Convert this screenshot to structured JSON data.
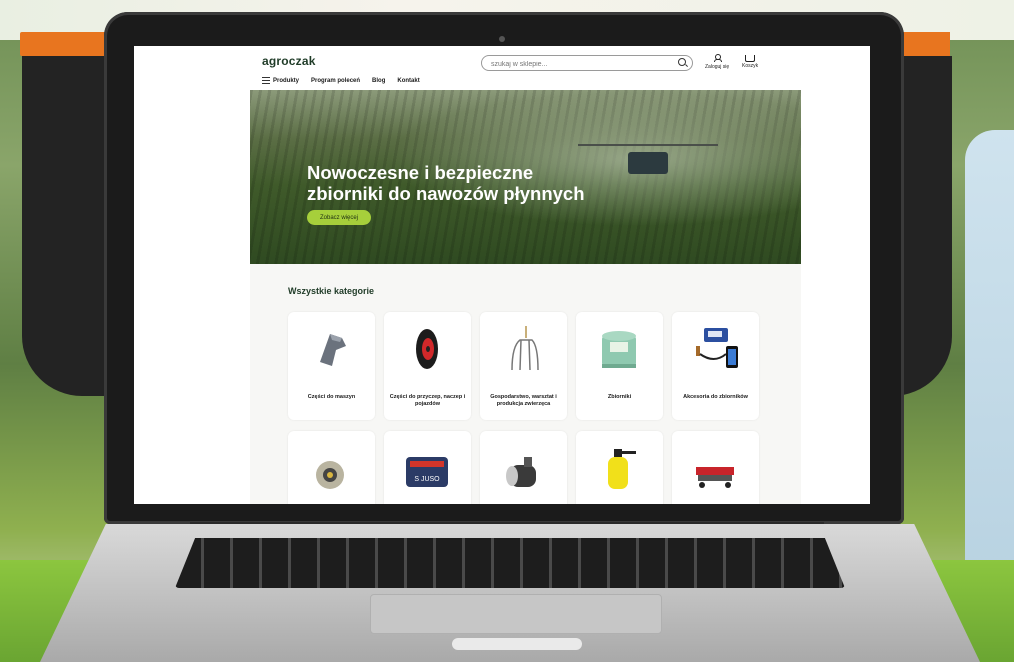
{
  "site": {
    "logo": "agroczak",
    "search_placeholder": "szukaj w sklepie...",
    "header_links": {
      "login": "Zaloguj się",
      "cart": "Koszyk"
    },
    "nav": [
      "Produkty",
      "Program poleceń",
      "Blog",
      "Kontakt"
    ],
    "hero": {
      "title_line1": "Nowoczesne i bezpieczne",
      "title_line2": "zbiorniki do nawozów płynnych",
      "button": "Zobacz więcej"
    },
    "categories_title": "Wszystkie kategorie",
    "categories": [
      {
        "label": "Części do maszyn",
        "icon": "machine-part-icon"
      },
      {
        "label": "Części do przyczep, naczep i pojazdów",
        "icon": "wheel-icon"
      },
      {
        "label": "Gospodarstwo, warsztat i produkcja zwierzęca",
        "icon": "pitchfork-icon"
      },
      {
        "label": "Zbiorniki",
        "icon": "tank-icon"
      },
      {
        "label": "Akcesoria do zbiorników",
        "icon": "tank-sensor-icon"
      },
      {
        "label": "",
        "icon": "alternator-icon"
      },
      {
        "label": "",
        "icon": "fuel-tank-icon",
        "badge": "S JUSO"
      },
      {
        "label": "",
        "icon": "solenoid-icon"
      },
      {
        "label": "",
        "icon": "sprayer-icon"
      },
      {
        "label": "",
        "icon": "seeder-icon"
      }
    ]
  },
  "colors": {
    "brand_green": "#a6cf3b",
    "brand_orange": "#e8751f",
    "dark_green": "#1f3b27"
  }
}
